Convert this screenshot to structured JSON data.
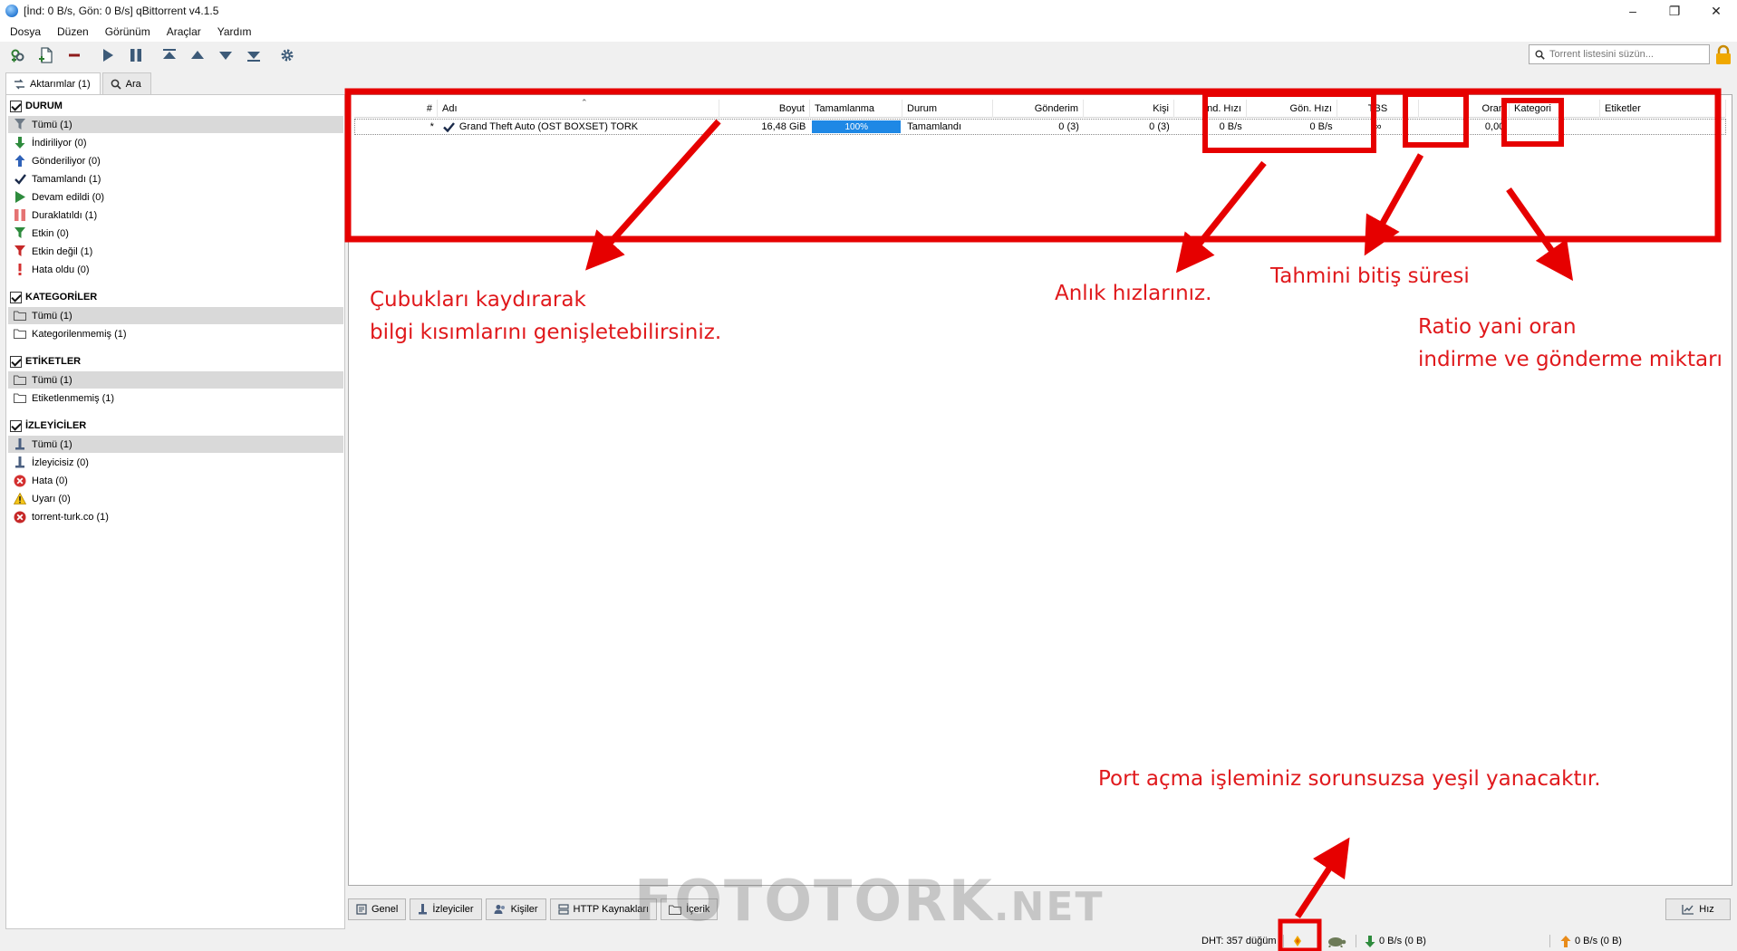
{
  "window": {
    "title": "[İnd: 0 B/s, Gön: 0 B/s] qBittorrent v4.1.5",
    "controls": {
      "minimize": "–",
      "maximize": "❐",
      "close": "✕"
    }
  },
  "menu": [
    "Dosya",
    "Düzen",
    "Görünüm",
    "Araçlar",
    "Yardım"
  ],
  "toolbar": {
    "buttons": [
      "add-link-icon",
      "add-file-icon",
      "remove-icon",
      "resume-icon",
      "pause-icon",
      "move-top-icon",
      "move-up-icon",
      "move-down-icon",
      "move-bottom-icon",
      "settings-icon"
    ],
    "search_placeholder": "Torrent listesini süzün..."
  },
  "left_tabs": {
    "transfers": "Aktarımlar (1)",
    "search": "Ara"
  },
  "sidebar": {
    "status": {
      "header": "DURUM",
      "items": [
        {
          "label": "Tümü (1)",
          "icon": "funnel-gray-icon",
          "selected": true
        },
        {
          "label": "İndiriliyor (0)",
          "icon": "arrow-down-green-icon"
        },
        {
          "label": "Gönderiliyor (0)",
          "icon": "arrow-up-blue-icon"
        },
        {
          "label": "Tamamlandı (1)",
          "icon": "check-icon"
        },
        {
          "label": "Devam edildi (0)",
          "icon": "play-green-icon"
        },
        {
          "label": "Duraklatıldı (1)",
          "icon": "pause-red-icon"
        },
        {
          "label": "Etkin (0)",
          "icon": "funnel-green-icon"
        },
        {
          "label": "Etkin değil (1)",
          "icon": "funnel-red-icon"
        },
        {
          "label": "Hata oldu (0)",
          "icon": "exclamation-icon"
        }
      ]
    },
    "categories": {
      "header": "KATEGORİLER",
      "items": [
        {
          "label": "Tümü (1)",
          "icon": "folder-icon",
          "selected": true
        },
        {
          "label": "Kategorilenmemiş (1)",
          "icon": "folder-icon"
        }
      ]
    },
    "tags": {
      "header": "ETİKETLER",
      "items": [
        {
          "label": "Tümü (1)",
          "icon": "folder-icon",
          "selected": true
        },
        {
          "label": "Etiketlenmemiş (1)",
          "icon": "folder-icon"
        }
      ]
    },
    "trackers": {
      "header": "İZLEYİCİLER",
      "items": [
        {
          "label": "Tümü (1)",
          "icon": "tracker-icon",
          "selected": true
        },
        {
          "label": "İzleyicisiz (0)",
          "icon": "tracker-icon"
        },
        {
          "label": "Hata (0)",
          "icon": "error-icon"
        },
        {
          "label": "Uyarı (0)",
          "icon": "warning-icon"
        },
        {
          "label": "torrent-turk.co (1)",
          "icon": "site-icon"
        }
      ]
    }
  },
  "table": {
    "columns": [
      "#",
      "Adı",
      "Boyut",
      "Tamamlanma",
      "Durum",
      "Gönderim",
      "Kişi",
      "İnd. Hızı",
      "Gön. Hızı",
      "TBS",
      "Oran",
      "Kategori",
      "Etiketler"
    ],
    "rows": [
      {
        "num": "*",
        "name": "Grand Theft Auto (OST BOXSET) TORK",
        "size": "16,48 GiB",
        "progress": "100%",
        "progress_value": 100,
        "status": "Tamamlandı",
        "seeds": "0 (3)",
        "peers": "0 (3)",
        "dl_speed": "0 B/s",
        "up_speed": "0 B/s",
        "eta": "∞",
        "ratio": "0,00",
        "category": "",
        "tags": ""
      }
    ]
  },
  "bottom_tabs": [
    "Genel",
    "İzleyiciler",
    "Kişiler",
    "HTTP Kaynakları",
    "İçerik"
  ],
  "speed_button": "Hız",
  "statusbar": {
    "dht": "DHT: 357 düğüm",
    "download": "0 B/s (0 B)",
    "upload": "0 B/s (0 B)"
  },
  "watermark": {
    "main": "FOTOTORK",
    "suffix": ".NET"
  },
  "annotations": {
    "drag_bars_line1": "Çubukları kaydırarak",
    "drag_bars_line2": "bilgi kısımlarını genişletebilirsiniz.",
    "speeds": "Anlık hızlarınız.",
    "eta": "Tahmini bitiş süresi",
    "ratio_line1": "Ratio yani oran",
    "ratio_line2": "indirme ve gönderme miktarı",
    "port": "Port açma işleminiz sorunsuzsa yeşil yanacaktır."
  },
  "colors": {
    "annotation_red": "#e0191c",
    "progress_blue": "#1e88e5",
    "selected_gray": "#d9d9d9"
  }
}
